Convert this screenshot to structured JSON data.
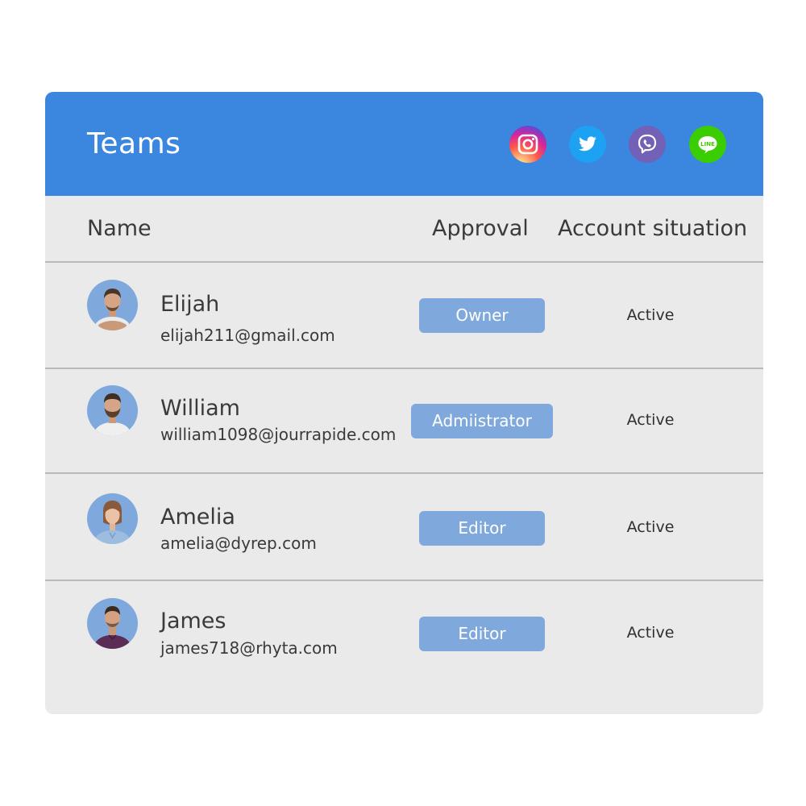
{
  "header": {
    "title": "Teams",
    "social_icons": [
      "instagram-icon",
      "twitter-icon",
      "viber-icon",
      "line-icon"
    ],
    "line_label": "LINE"
  },
  "columns": {
    "name": "Name",
    "approval": "Approval",
    "account": "Account situation"
  },
  "members": [
    {
      "name": "Elijah",
      "email": "elijah211@gmail.com",
      "role": "Owner",
      "status": "Active",
      "avatar": "man-crossed-arms"
    },
    {
      "name": "William",
      "email": "william1098@jourrapide.com",
      "role": "Admiistrator",
      "status": "Active",
      "avatar": "bearded-man"
    },
    {
      "name": "Amelia",
      "email": "amelia@dyrep.com",
      "role": "Editor",
      "status": "Active",
      "avatar": "woman-denim-shirt"
    },
    {
      "name": "James",
      "email": "james718@rhyta.com",
      "role": "Editor",
      "status": "Active",
      "avatar": "man-purple-shirt"
    }
  ],
  "colors": {
    "header": "#3b87df",
    "card": "#eaeaea",
    "badge": "#7fa9dd",
    "divider": "#b9b9b9",
    "text": "#3a3a3a"
  }
}
